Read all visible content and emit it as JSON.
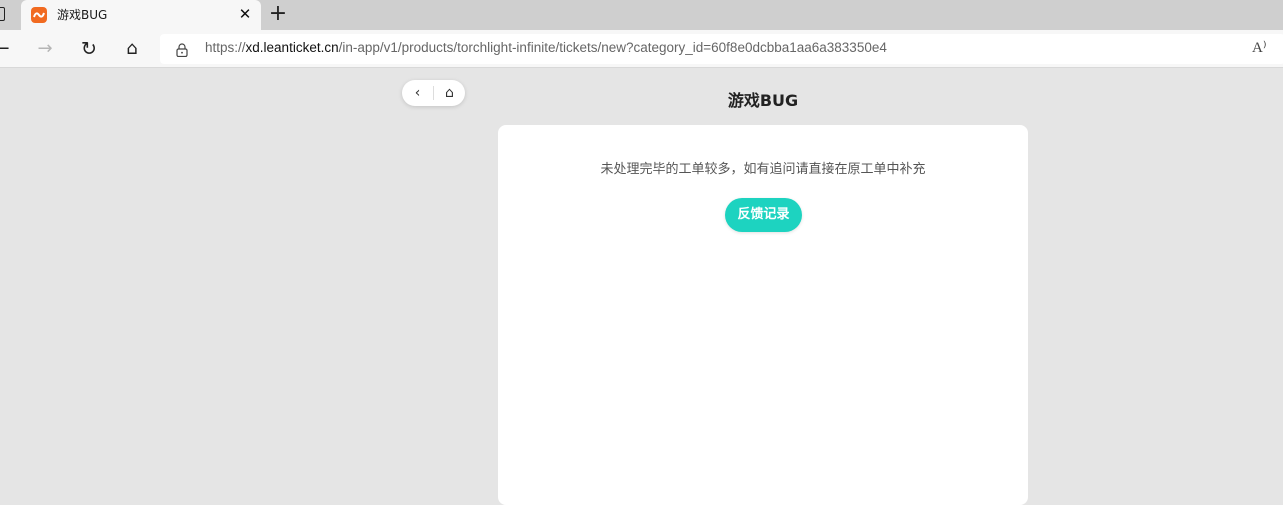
{
  "browser": {
    "tab": {
      "title": "游戏BUG",
      "close_glyph": "✕"
    },
    "new_tab_glyph": "+",
    "nav": {
      "back_glyph": "←",
      "forward_glyph": "→",
      "refresh_glyph": "↻",
      "home_glyph": "⌂"
    },
    "url": {
      "prefix": "https://",
      "host": "xd.leanticket.cn",
      "path": "/in-app/v1/products/torchlight-infinite/tickets/new?category_id=60f8e0dcbba1aa6a383350e4"
    },
    "read_aloud_glyph": "A⁾"
  },
  "page": {
    "nav_pill": {
      "back_glyph": "‹",
      "home_glyph": "⌂"
    },
    "title": "游戏BUG",
    "notice": "未处理完毕的工单较多，如有追问请直接在原工单中补充",
    "feedback_button": "反馈记录"
  },
  "colors": {
    "accent": "#1dd3c0",
    "favicon": "#f16a20"
  }
}
